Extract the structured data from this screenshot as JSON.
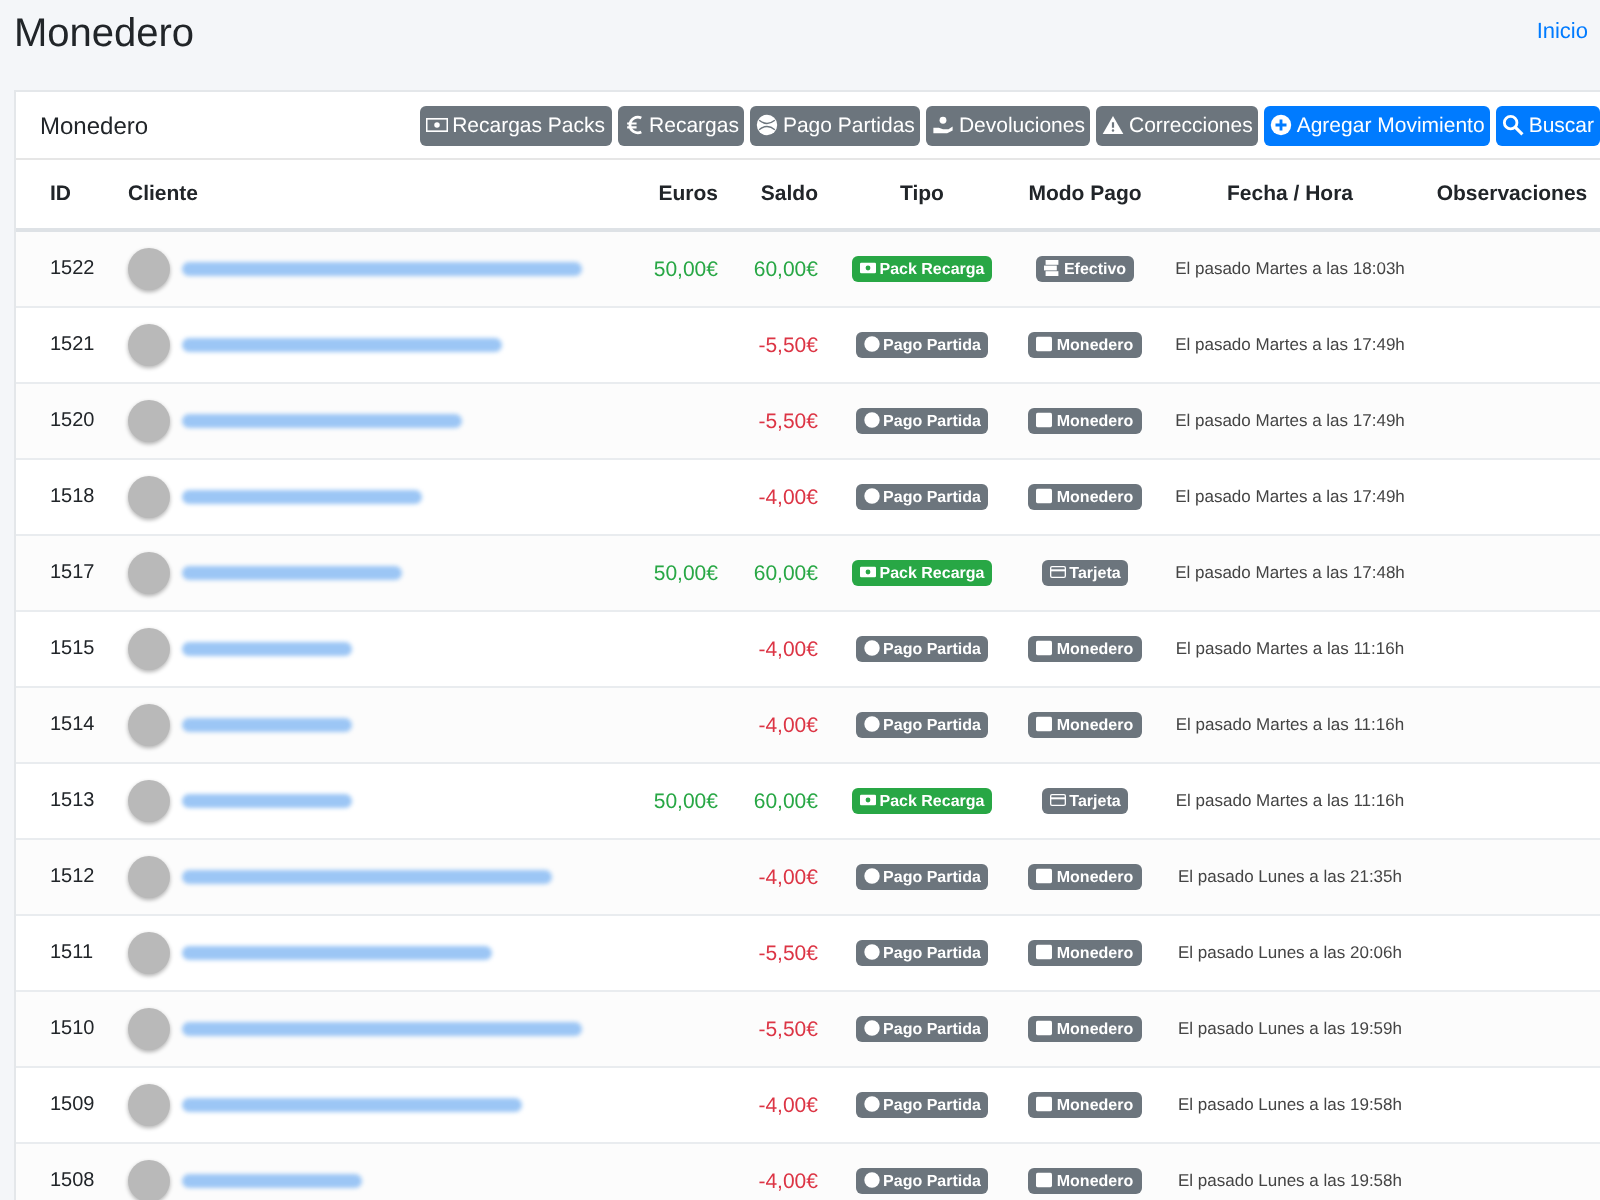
{
  "page": {
    "title": "Monedero",
    "breadcrumb": "Inicio"
  },
  "card": {
    "title": "Monedero",
    "buttons": [
      {
        "label": "Recargas Packs",
        "kind": "packs"
      },
      {
        "label": "Recargas",
        "kind": "euro"
      },
      {
        "label": "Pago Partidas",
        "kind": "ball"
      },
      {
        "label": "Devoluciones",
        "kind": "hand"
      },
      {
        "label": "Correcciones",
        "kind": "warning"
      },
      {
        "label": "Agregar Movimiento",
        "kind": "plus"
      },
      {
        "label": "Buscar",
        "kind": "search"
      }
    ]
  },
  "table": {
    "columns": [
      "ID",
      "Cliente",
      "Euros",
      "Saldo",
      "Tipo",
      "Modo Pago",
      "Fecha / Hora",
      "Observaciones"
    ],
    "rows": [
      {
        "id": "1522",
        "euros": "50,00€",
        "saldo": "60,00€",
        "tipo": {
          "label": "Pack Recarga",
          "kind": "recarga"
        },
        "modo": {
          "label": "Efectivo",
          "kind": "efectivo"
        },
        "fecha": "El pasado Martes a las 18:03h"
      },
      {
        "id": "1521",
        "saldo": "-5,50€",
        "tipo": {
          "label": "Pago Partida",
          "kind": "pago"
        },
        "modo": {
          "label": "Monedero",
          "kind": "monedero"
        },
        "fecha": "El pasado Martes a las 17:49h"
      },
      {
        "id": "1520",
        "saldo": "-5,50€",
        "tipo": {
          "label": "Pago Partida",
          "kind": "pago"
        },
        "modo": {
          "label": "Monedero",
          "kind": "monedero"
        },
        "fecha": "El pasado Martes a las 17:49h"
      },
      {
        "id": "1518",
        "saldo": "-4,00€",
        "tipo": {
          "label": "Pago Partida",
          "kind": "pago"
        },
        "modo": {
          "label": "Monedero",
          "kind": "monedero"
        },
        "fecha": "El pasado Martes a las 17:49h"
      },
      {
        "id": "1517",
        "euros": "50,00€",
        "saldo": "60,00€",
        "tipo": {
          "label": "Pack Recarga",
          "kind": "recarga"
        },
        "modo": {
          "label": "Tarjeta",
          "kind": "tarjeta"
        },
        "fecha": "El pasado Martes a las 17:48h"
      },
      {
        "id": "1515",
        "saldo": "-4,00€",
        "tipo": {
          "label": "Pago Partida",
          "kind": "pago"
        },
        "modo": {
          "label": "Monedero",
          "kind": "monedero"
        },
        "fecha": "El pasado Martes a las 11:16h"
      },
      {
        "id": "1514",
        "saldo": "-4,00€",
        "tipo": {
          "label": "Pago Partida",
          "kind": "pago"
        },
        "modo": {
          "label": "Monedero",
          "kind": "monedero"
        },
        "fecha": "El pasado Martes a las 11:16h"
      },
      {
        "id": "1513",
        "euros": "50,00€",
        "saldo": "60,00€",
        "tipo": {
          "label": "Pack Recarga",
          "kind": "recarga"
        },
        "modo": {
          "label": "Tarjeta",
          "kind": "tarjeta"
        },
        "fecha": "El pasado Martes a las 11:16h"
      },
      {
        "id": "1512",
        "saldo": "-4,00€",
        "tipo": {
          "label": "Pago Partida",
          "kind": "pago"
        },
        "modo": {
          "label": "Monedero",
          "kind": "monedero"
        },
        "fecha": "El pasado Lunes a las 21:35h"
      },
      {
        "id": "1511",
        "saldo": "-5,50€",
        "tipo": {
          "label": "Pago Partida",
          "kind": "pago"
        },
        "modo": {
          "label": "Monedero",
          "kind": "monedero"
        },
        "fecha": "El pasado Lunes a las 20:06h"
      },
      {
        "id": "1510",
        "saldo": "-5,50€",
        "tipo": {
          "label": "Pago Partida",
          "kind": "pago"
        },
        "modo": {
          "label": "Monedero",
          "kind": "monedero"
        },
        "fecha": "El pasado Lunes a las 19:59h"
      },
      {
        "id": "1509",
        "saldo": "-4,00€",
        "tipo": {
          "label": "Pago Partida",
          "kind": "pago"
        },
        "modo": {
          "label": "Monedero",
          "kind": "monedero"
        },
        "fecha": "El pasado Lunes a las 19:58h"
      },
      {
        "id": "1508",
        "saldo": "-4,00€",
        "tipo": {
          "label": "Pago Partida",
          "kind": "pago"
        },
        "modo": {
          "label": "Monedero",
          "kind": "monedero"
        },
        "fecha": "El pasado Lunes a las 19:58h"
      }
    ]
  }
}
